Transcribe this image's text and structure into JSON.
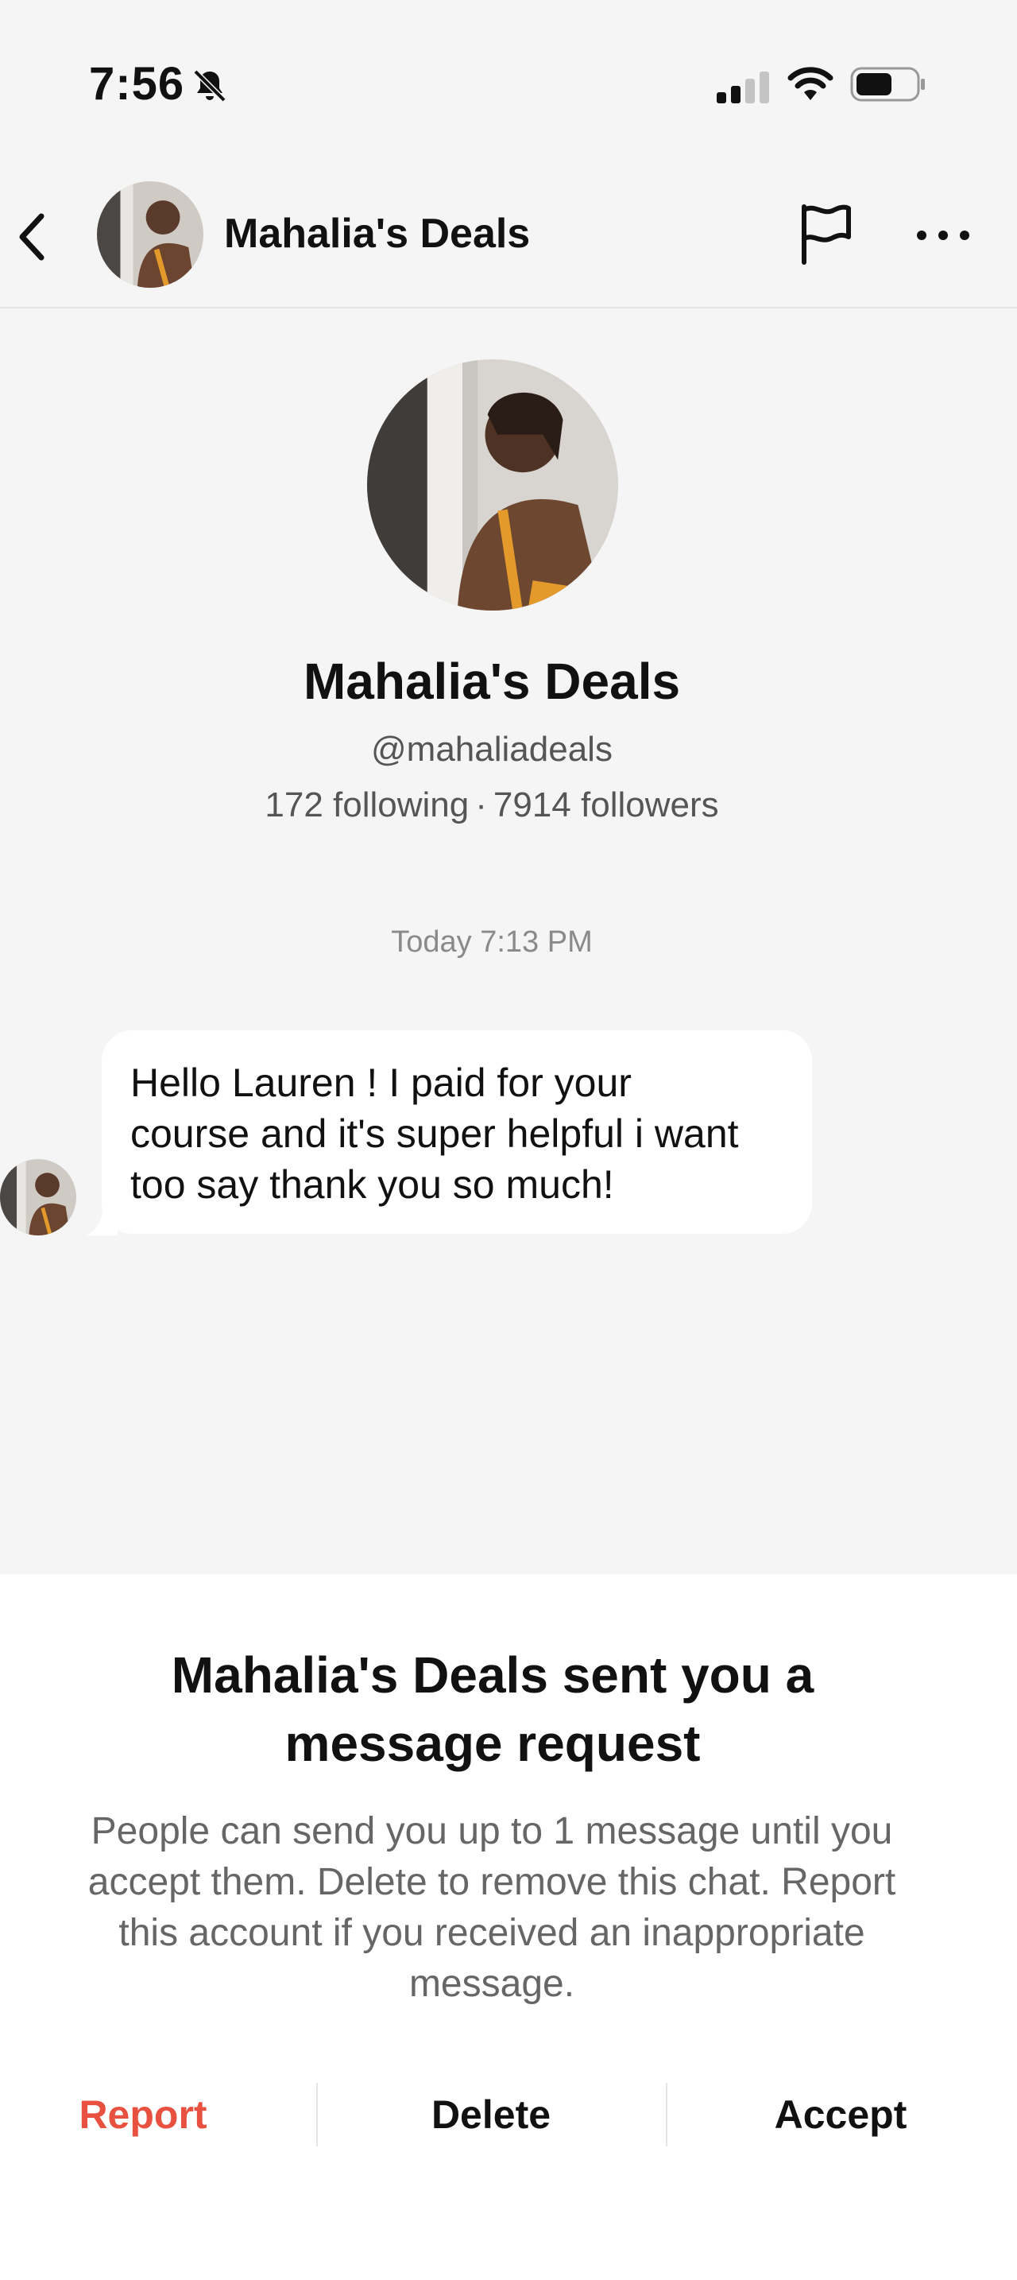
{
  "status_bar": {
    "time": "7:56",
    "icons": [
      "bell-slash-icon",
      "signal-icon",
      "wifi-icon",
      "battery-icon"
    ]
  },
  "nav": {
    "title": "Mahalia's Deals",
    "icons": [
      "back-icon",
      "flag-icon",
      "more-icon"
    ]
  },
  "profile": {
    "name": "Mahalia's Deals",
    "handle": "@mahaliadeals",
    "following": "172 following",
    "separator": "·",
    "followers": "7914 followers"
  },
  "chat": {
    "timestamp": "Today 7:13 PM",
    "messages": [
      {
        "line1": "Hello Lauren ! I paid for your",
        "line2": "course and it's super helpful i want",
        "line3": "too say thank you so much!"
      }
    ]
  },
  "request_sheet": {
    "title_line1": "Mahalia's Deals sent you a",
    "title_line2": "message request",
    "body_line1": "People can send you up to 1 message until you",
    "body_line2": "accept them. Delete to remove this chat. Report",
    "body_line3": "this account if you received an inappropriate",
    "body_line4": "message.",
    "report_label": "Report",
    "delete_label": "Delete",
    "accept_label": "Accept"
  },
  "colors": {
    "background": "#f5f5f5",
    "sheet": "#ffffff",
    "report": "#e8503f",
    "muted_text": "#666666"
  }
}
